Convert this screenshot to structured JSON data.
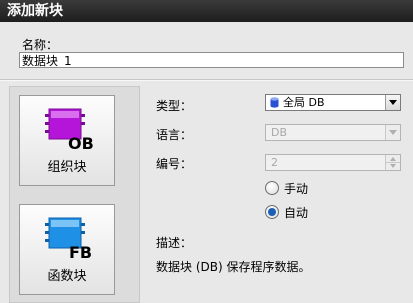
{
  "dialog": {
    "title": "添加新块"
  },
  "name": {
    "label": "名称：",
    "value": "数据块_1"
  },
  "blocks": [
    {
      "id": "OB",
      "label": "组织块",
      "icon": "ob-block-icon",
      "color": "#b515d8"
    },
    {
      "id": "FB",
      "label": "函数块",
      "icon": "fb-block-icon",
      "color": "#1e90e6"
    }
  ],
  "fields": {
    "type": {
      "label": "类型：",
      "value": "全局 DB",
      "icon": "db-cylinder-icon"
    },
    "language": {
      "label": "语言：",
      "value": "DB"
    },
    "number": {
      "label": "编号：",
      "value": "2"
    }
  },
  "numbering": {
    "manual_label": "手动",
    "auto_label": "自动",
    "selected": "auto"
  },
  "description": {
    "label": "描述：",
    "text": "数据块 (DB) 保存程序数据。"
  },
  "colors": {
    "titlebar": "#2a2a2a",
    "radio_selected": "#1a5fb4",
    "db_icon": "#2a52d0"
  }
}
